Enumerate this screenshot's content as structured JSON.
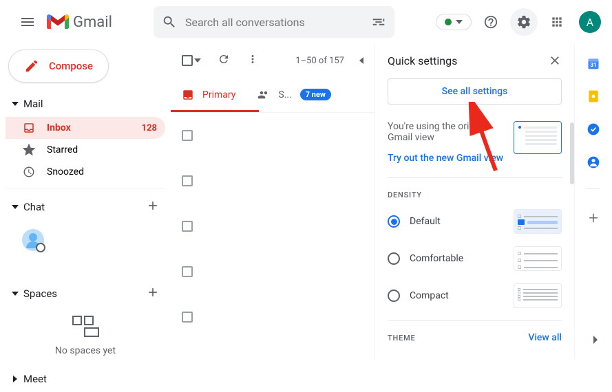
{
  "header": {
    "app_name": "Gmail",
    "search_placeholder": "Search all conversations",
    "avatar_letter": "A"
  },
  "sidebar": {
    "compose_label": "Compose",
    "sections": {
      "mail": "Mail",
      "chat": "Chat",
      "spaces": "Spaces",
      "meet": "Meet"
    },
    "nav": [
      {
        "label": "Inbox",
        "count": "128",
        "active": true
      },
      {
        "label": "Starred"
      },
      {
        "label": "Snoozed"
      }
    ],
    "no_spaces": "No spaces yet"
  },
  "toolbar": {
    "pagination": "1–50 of 157"
  },
  "tabs": {
    "primary": "Primary",
    "social_short": "S...",
    "badge": "7 new"
  },
  "settings": {
    "title": "Quick settings",
    "see_all": "See all settings",
    "view_notice": "You're using the original Gmail view",
    "try_new": "Try out the new Gmail view",
    "density_label": "DENSITY",
    "density": [
      {
        "label": "Default",
        "checked": true
      },
      {
        "label": "Comfortable",
        "checked": false
      },
      {
        "label": "Compact",
        "checked": false
      }
    ],
    "theme_label": "THEME",
    "view_all": "View all"
  }
}
